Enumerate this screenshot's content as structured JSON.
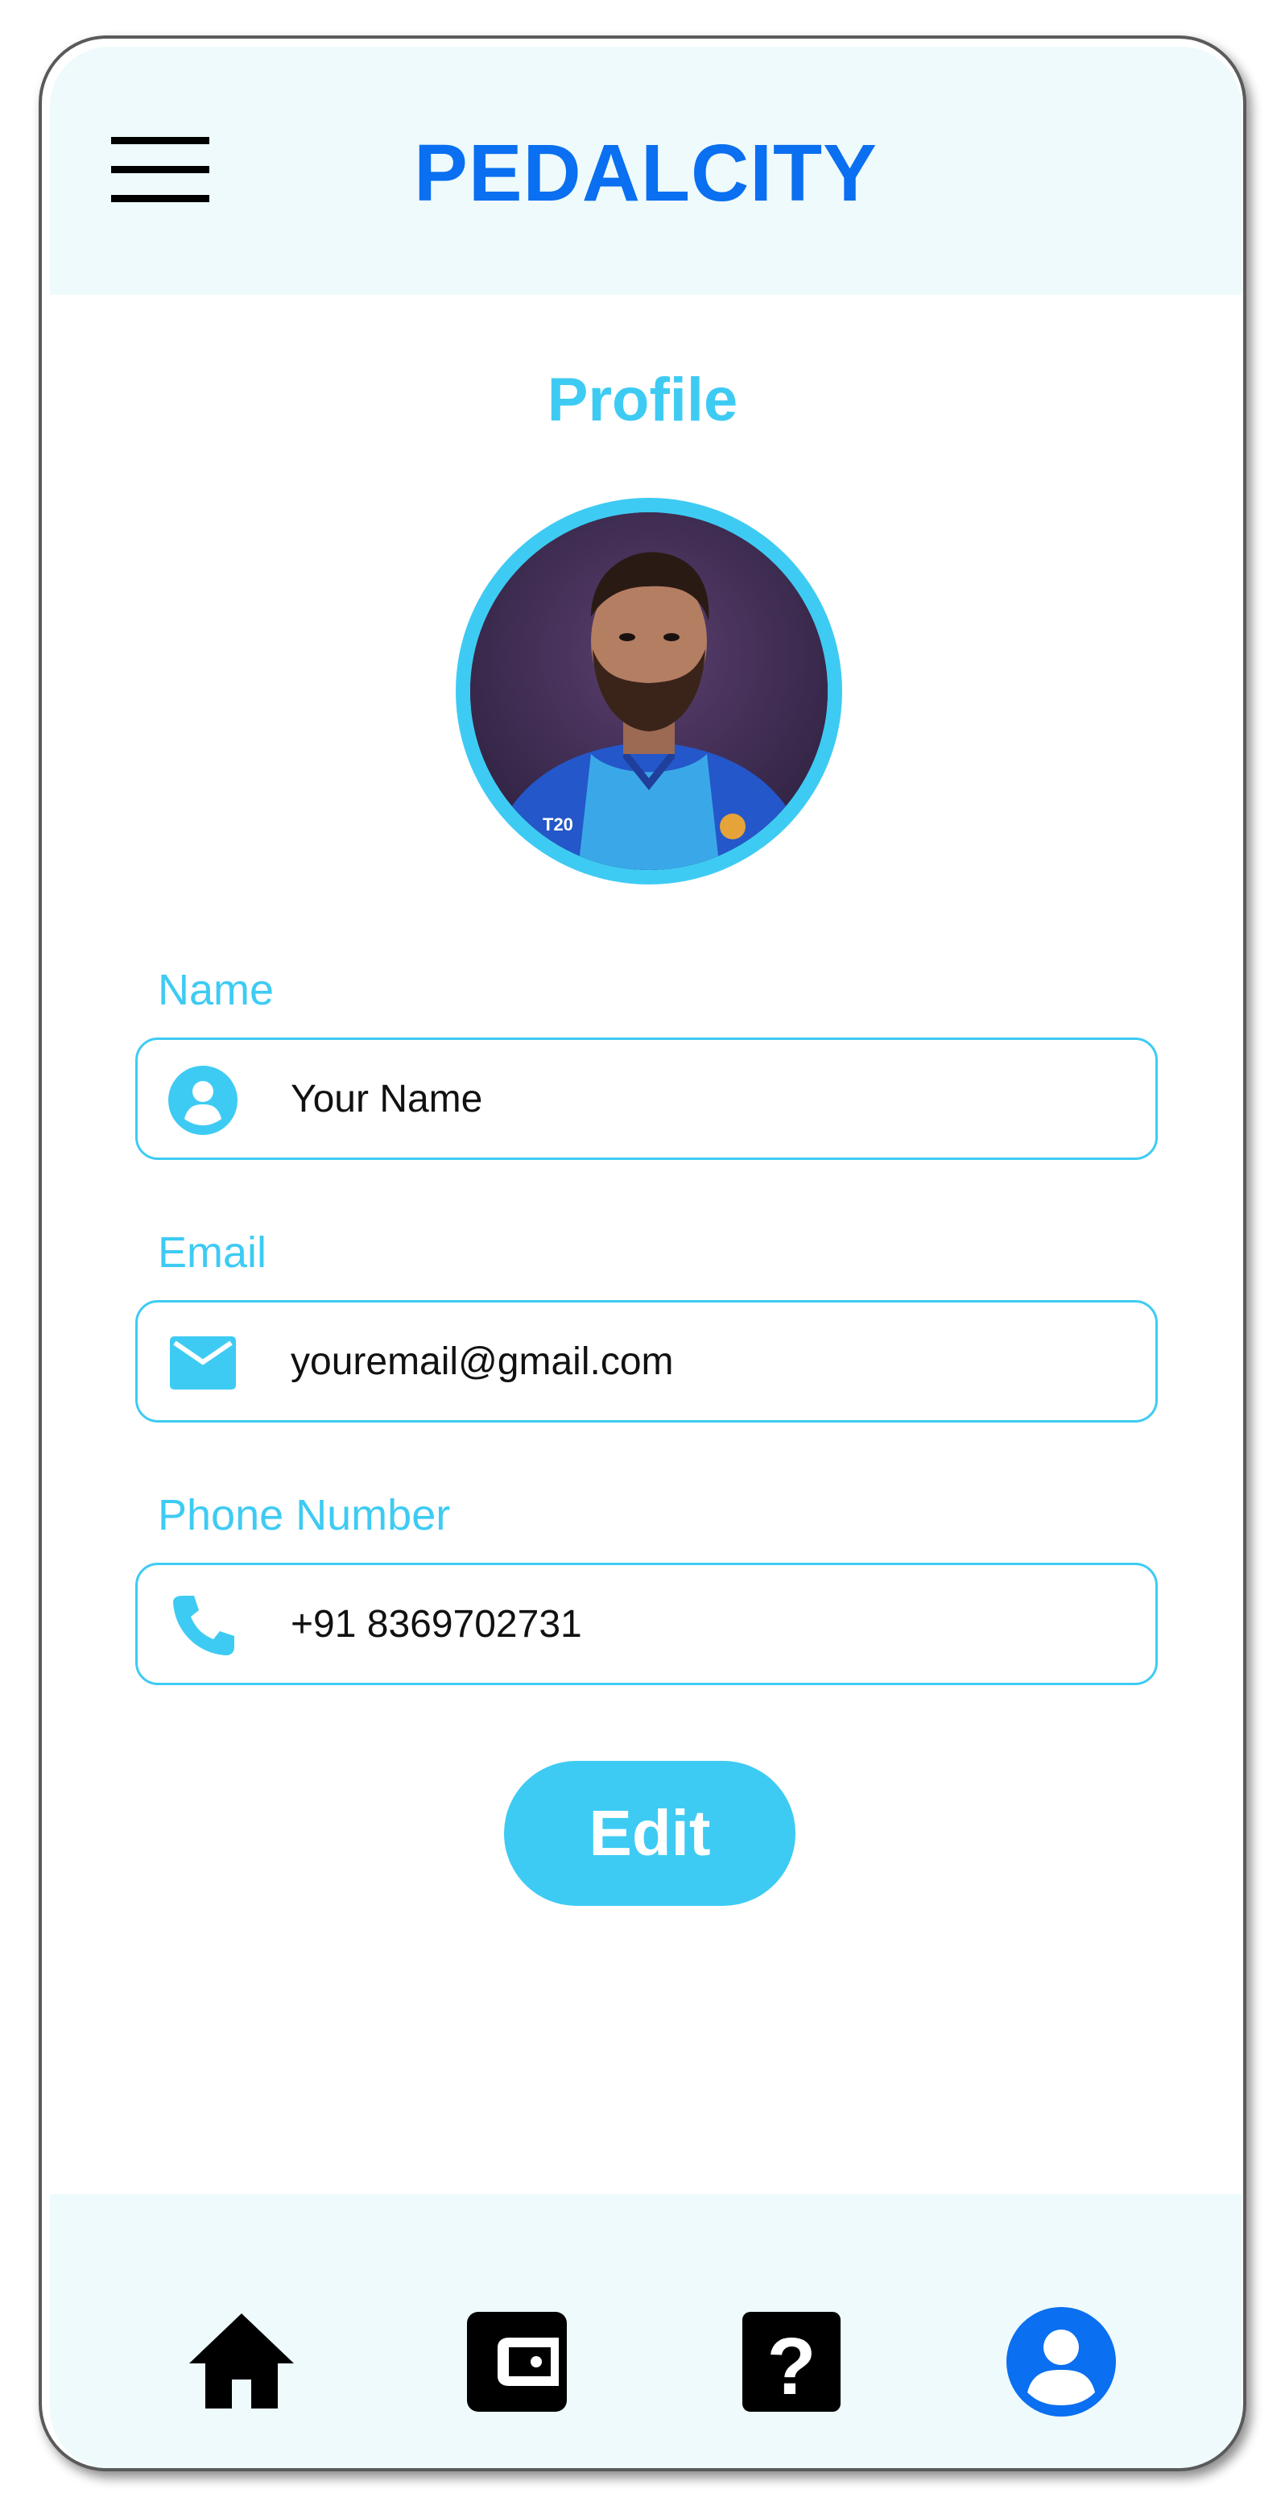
{
  "app": {
    "brand": "PEDALCITY",
    "menu_icon": "hamburger-menu-icon"
  },
  "profile": {
    "title": "Profile",
    "avatar_alt": "profile-photo"
  },
  "fields": {
    "name": {
      "label": "Name",
      "value": "Your Name",
      "icon": "user-icon"
    },
    "email": {
      "label": "Email",
      "value": "youremail@gmail.com",
      "icon": "mail-icon"
    },
    "phone": {
      "label": "Phone Number",
      "value": "+91 8369702731",
      "icon": "phone-icon"
    }
  },
  "actions": {
    "edit_label": "Edit"
  },
  "bottom_nav": {
    "items": [
      {
        "icon": "home-icon",
        "active": false
      },
      {
        "icon": "wallet-icon",
        "active": false
      },
      {
        "icon": "help-icon",
        "active": false
      },
      {
        "icon": "profile-icon",
        "active": true
      }
    ]
  },
  "colors": {
    "brand": "#0a6ff0",
    "accent": "#3ecbf3",
    "header_bg": "#eefafc",
    "active_nav": "#0a6ff0"
  }
}
